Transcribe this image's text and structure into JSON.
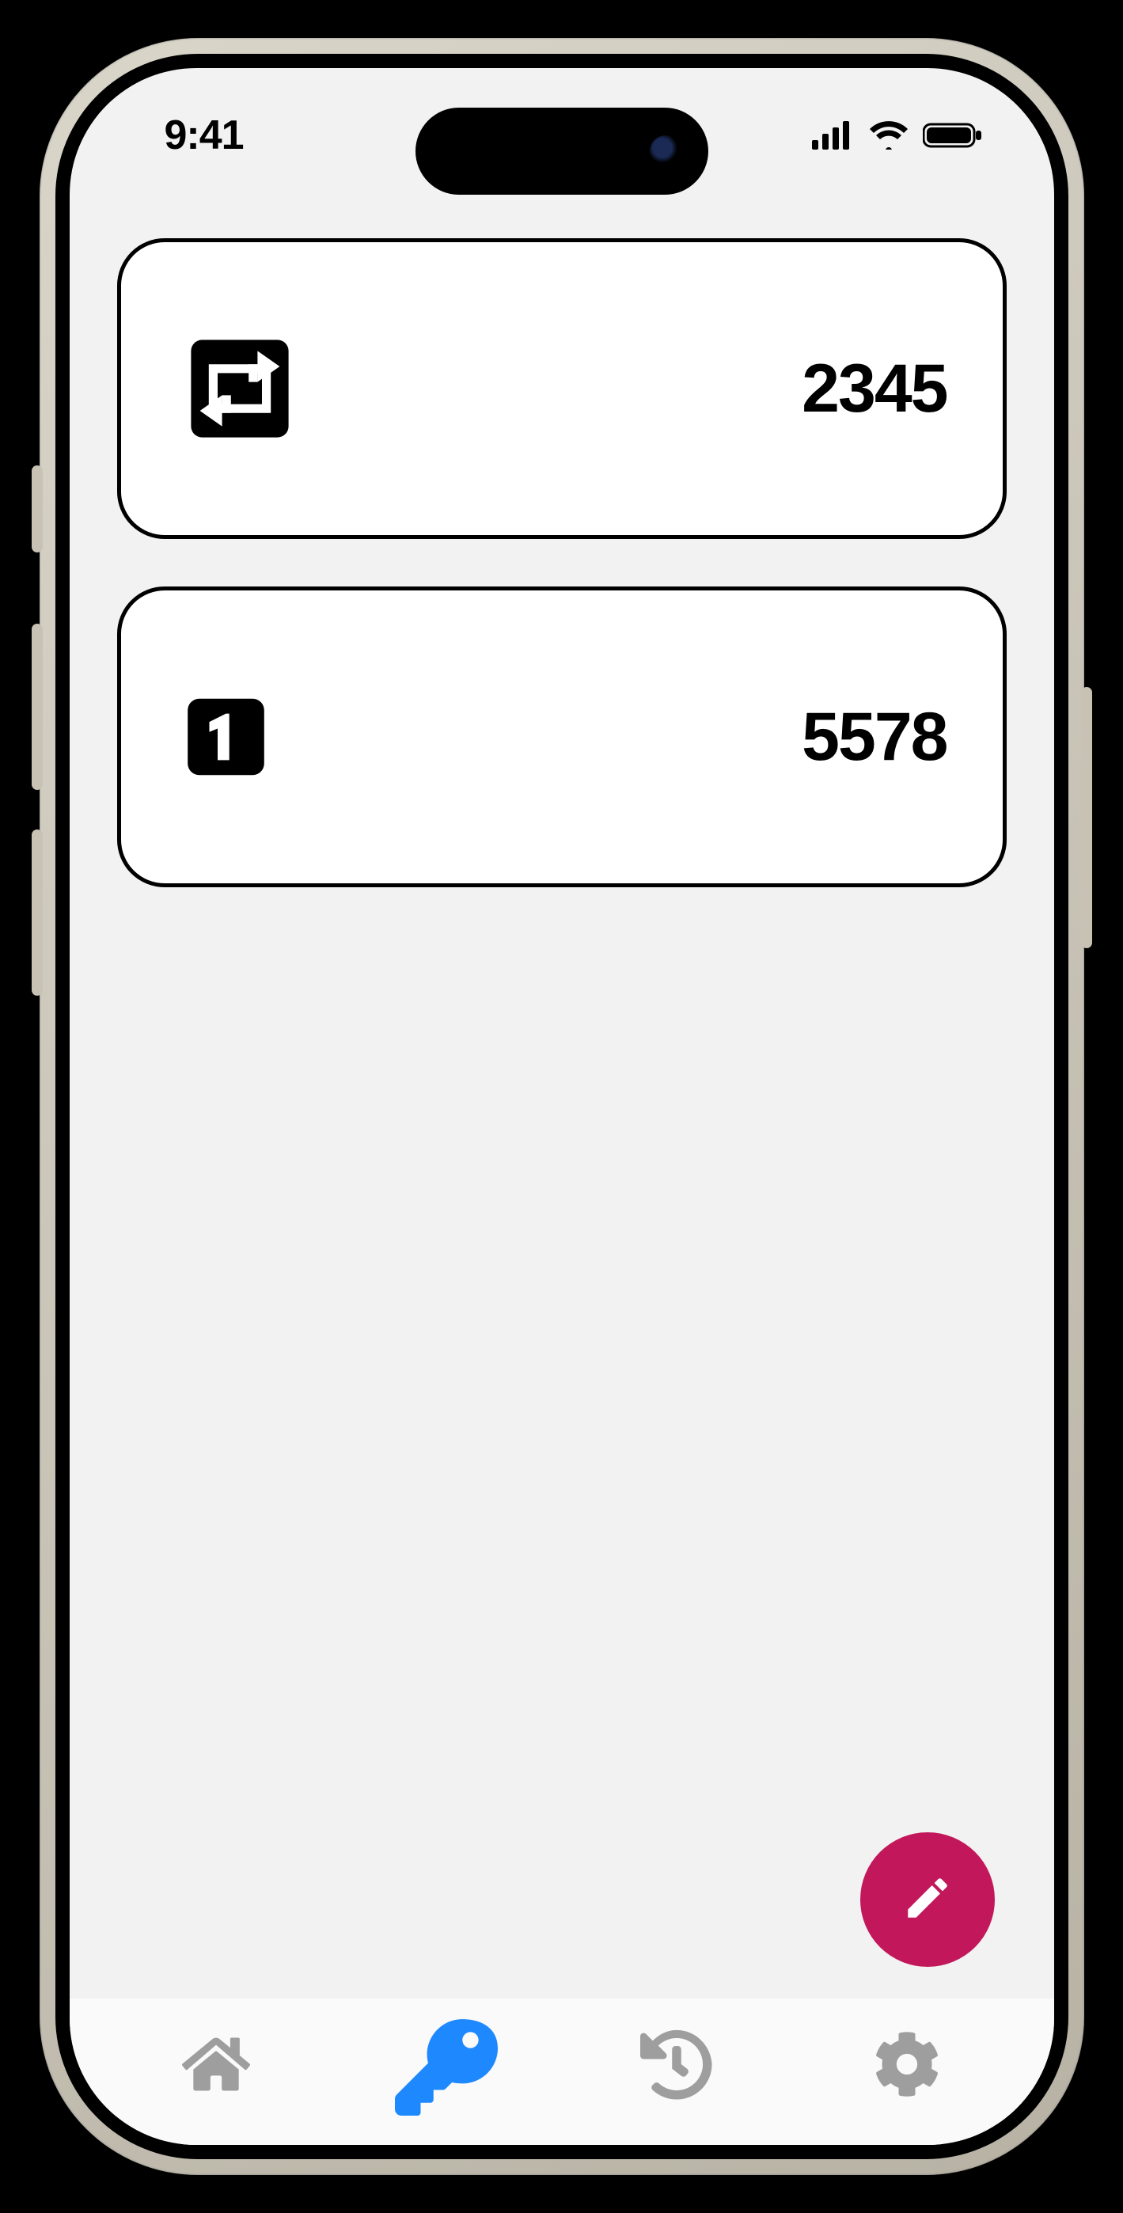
{
  "status": {
    "time": "9:41"
  },
  "cards": [
    {
      "icon": "repeat-icon",
      "value": "2345"
    },
    {
      "icon": "one-icon",
      "value": "5578"
    }
  ],
  "fab": {
    "icon": "edit-icon"
  },
  "nav": {
    "items": [
      {
        "id": "home",
        "icon": "house-icon",
        "active": false
      },
      {
        "id": "keys",
        "icon": "key-icon",
        "active": true
      },
      {
        "id": "history",
        "icon": "history-icon",
        "active": false
      },
      {
        "id": "settings",
        "icon": "gear-icon",
        "active": false
      }
    ],
    "activeColor": "#1e88ff",
    "inactiveColor": "#9e9e9e"
  },
  "colors": {
    "fab": "#c2185b"
  }
}
